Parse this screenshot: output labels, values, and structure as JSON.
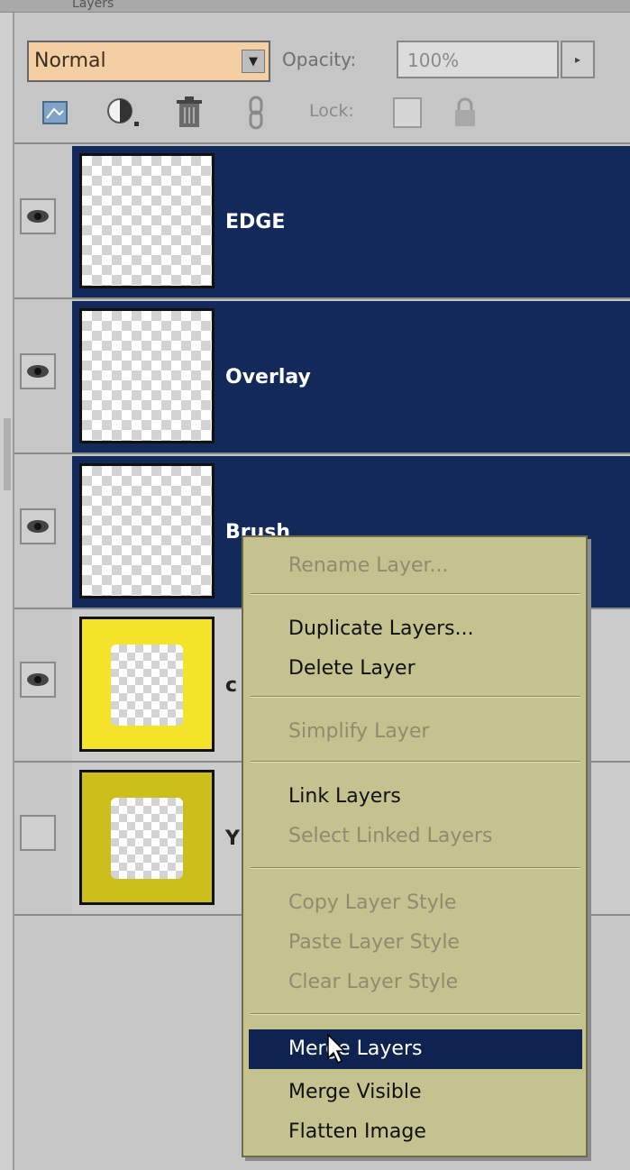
{
  "panel": {
    "title": "Layers"
  },
  "controls": {
    "blend_mode": "Normal",
    "opacity_label": "Opacity:",
    "opacity_value": "100%",
    "lock_label": "Lock:"
  },
  "toolbar_icons": [
    "new-layer-icon",
    "adjustment-layer-icon",
    "trash-icon",
    "link-icon",
    "lock-transparency-icon",
    "lock-all-icon"
  ],
  "layers": [
    {
      "name": "EDGE",
      "visible": true,
      "selected": true
    },
    {
      "name": "Overlay",
      "visible": true,
      "selected": true
    },
    {
      "name": "Brush",
      "visible": true,
      "selected": true
    },
    {
      "name": "c",
      "visible": true,
      "selected": false
    },
    {
      "name": "Y",
      "visible": false,
      "selected": false
    }
  ],
  "context_menu": {
    "items": [
      {
        "label": "Rename Layer...",
        "enabled": false
      },
      {
        "label": "Duplicate Layers...",
        "enabled": true
      },
      {
        "label": "Delete Layer",
        "enabled": true
      },
      {
        "label": "Simplify Layer",
        "enabled": false
      },
      {
        "label": "Link Layers",
        "enabled": true
      },
      {
        "label": "Select Linked Layers",
        "enabled": false
      },
      {
        "label": "Copy Layer Style",
        "enabled": false
      },
      {
        "label": "Paste Layer Style",
        "enabled": false
      },
      {
        "label": "Clear Layer Style",
        "enabled": false
      },
      {
        "label": "Merge Layers",
        "enabled": true,
        "highlighted": true
      },
      {
        "label": "Merge Visible",
        "enabled": true
      },
      {
        "label": "Flatten Image",
        "enabled": true
      }
    ]
  },
  "colors": {
    "selection": "#13295a",
    "menu_bg": "#c4c28f",
    "blend_field": "#f4cfa3"
  }
}
